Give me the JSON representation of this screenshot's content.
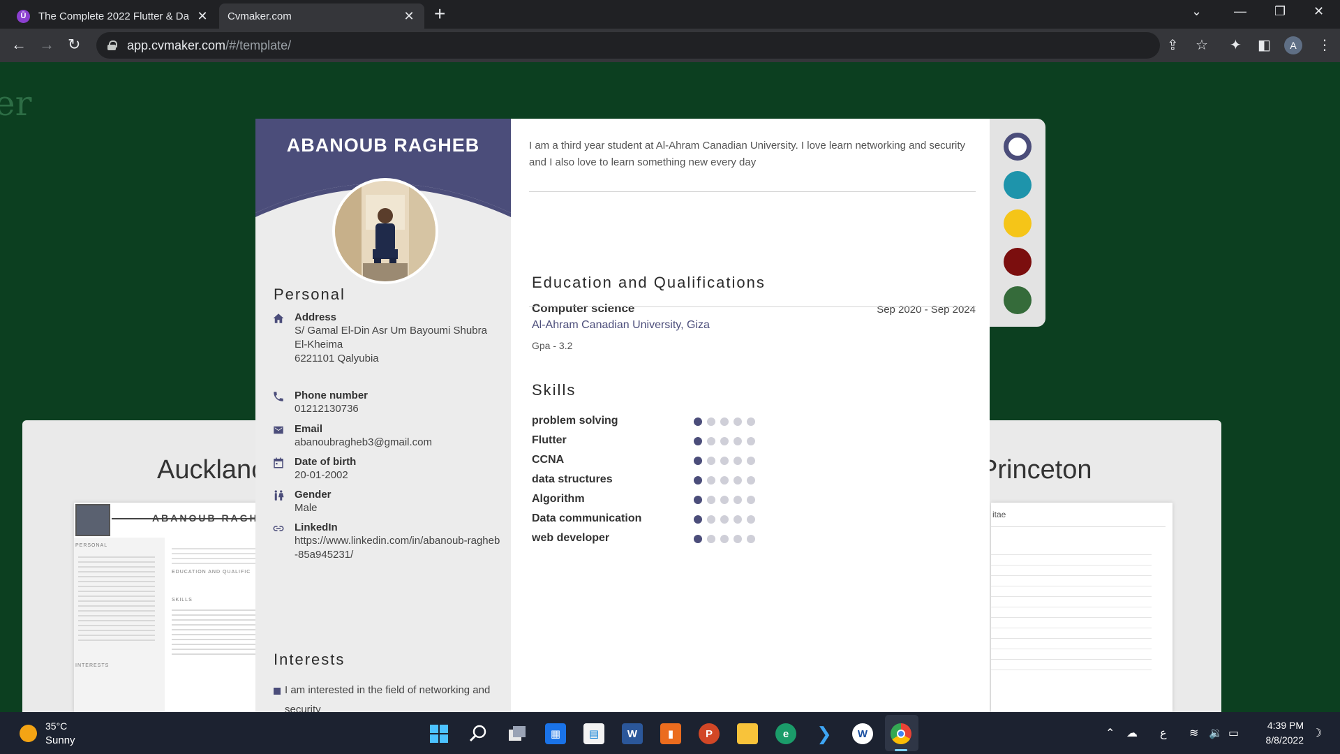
{
  "browser": {
    "tabs": [
      {
        "title": "The Complete 2022 Flutter & Da",
        "favicon": "udemy-icon"
      },
      {
        "title": "Cvmaker.com",
        "favicon": "cv-icon"
      }
    ],
    "favicon_labels": {
      "udemy": "Ū",
      "cv": "CV"
    },
    "url_host": "app.cvmaker.com",
    "url_path": "/#/template/",
    "profile_initial": "A"
  },
  "page": {
    "brand_fragment": "er",
    "gallery_templates": [
      "Aucklanc",
      "Princeton"
    ],
    "ghost_cv": {
      "name": "ABANOUB RAGHE",
      "section_personal": "PERSONAL",
      "section_education": "EDUCATION AND QUALIFIC",
      "section_skills": "SKILLS",
      "section_interests": "INTERESTS",
      "right_title": "itae"
    }
  },
  "cv": {
    "name": "ABANOUB RAGHEB",
    "summary": "I am a third year student at Al-Ahram Canadian University. I love learn networking and security and I also love to learn something new every day",
    "sections": {
      "personal": "Personal",
      "interests": "Interests",
      "education": "Education and Qualifications",
      "skills": "Skills"
    },
    "personal": [
      {
        "icon": "home-icon",
        "label": "Address",
        "value": "S/ Gamal El-Din Asr Um Bayoumi Shubra El-Kheima\n6221101 Qalyubia"
      },
      {
        "icon": "phone-icon",
        "label": "Phone number",
        "value": "01212130736"
      },
      {
        "icon": "email-icon",
        "label": "Email",
        "value": "abanoubragheb3@gmail.com"
      },
      {
        "icon": "calendar-icon",
        "label": "Date of birth",
        "value": "20-01-2002"
      },
      {
        "icon": "gender-icon",
        "label": "Gender",
        "value": "Male"
      },
      {
        "icon": "link-icon",
        "label": "LinkedIn",
        "value": "https://www.linkedin.com/in/abanoub-ragheb-85a945231/"
      }
    ],
    "interests": [
      "I am interested in the field of networking and security"
    ],
    "education": {
      "degree": "Computer science",
      "school": "Al-Ahram Canadian University, Giza",
      "gpa": "Gpa - 3.2",
      "dates": "Sep 2020 - Sep 2024"
    },
    "skills": [
      {
        "name": "problem solving",
        "level": 1,
        "max": 5
      },
      {
        "name": "Flutter",
        "level": 1,
        "max": 5
      },
      {
        "name": "CCNA",
        "level": 1,
        "max": 5
      },
      {
        "name": "data structures",
        "level": 1,
        "max": 5
      },
      {
        "name": "Algorithm",
        "level": 1,
        "max": 5
      },
      {
        "name": "Data communication",
        "level": 1,
        "max": 5
      },
      {
        "name": "web developer",
        "level": 1,
        "max": 5
      }
    ]
  },
  "palette": {
    "selected": "#4b4d7a",
    "colors": [
      "#4b4d7a",
      "#1e94ab",
      "#f5c518",
      "#7b0e0e",
      "#356b3a"
    ]
  },
  "taskbar": {
    "temperature": "35°C",
    "condition": "Sunny",
    "time": "4:39 PM",
    "date": "8/8/2022",
    "input_language": "ع",
    "apps": [
      "start-icon",
      "search-icon",
      "task-view-icon",
      "calendar-app-icon",
      "store-icon",
      "word-icon",
      "office-icon",
      "powerpoint-icon",
      "file-explorer-icon",
      "edge-icon",
      "vscode-icon",
      "app-icon",
      "chrome-icon"
    ]
  }
}
